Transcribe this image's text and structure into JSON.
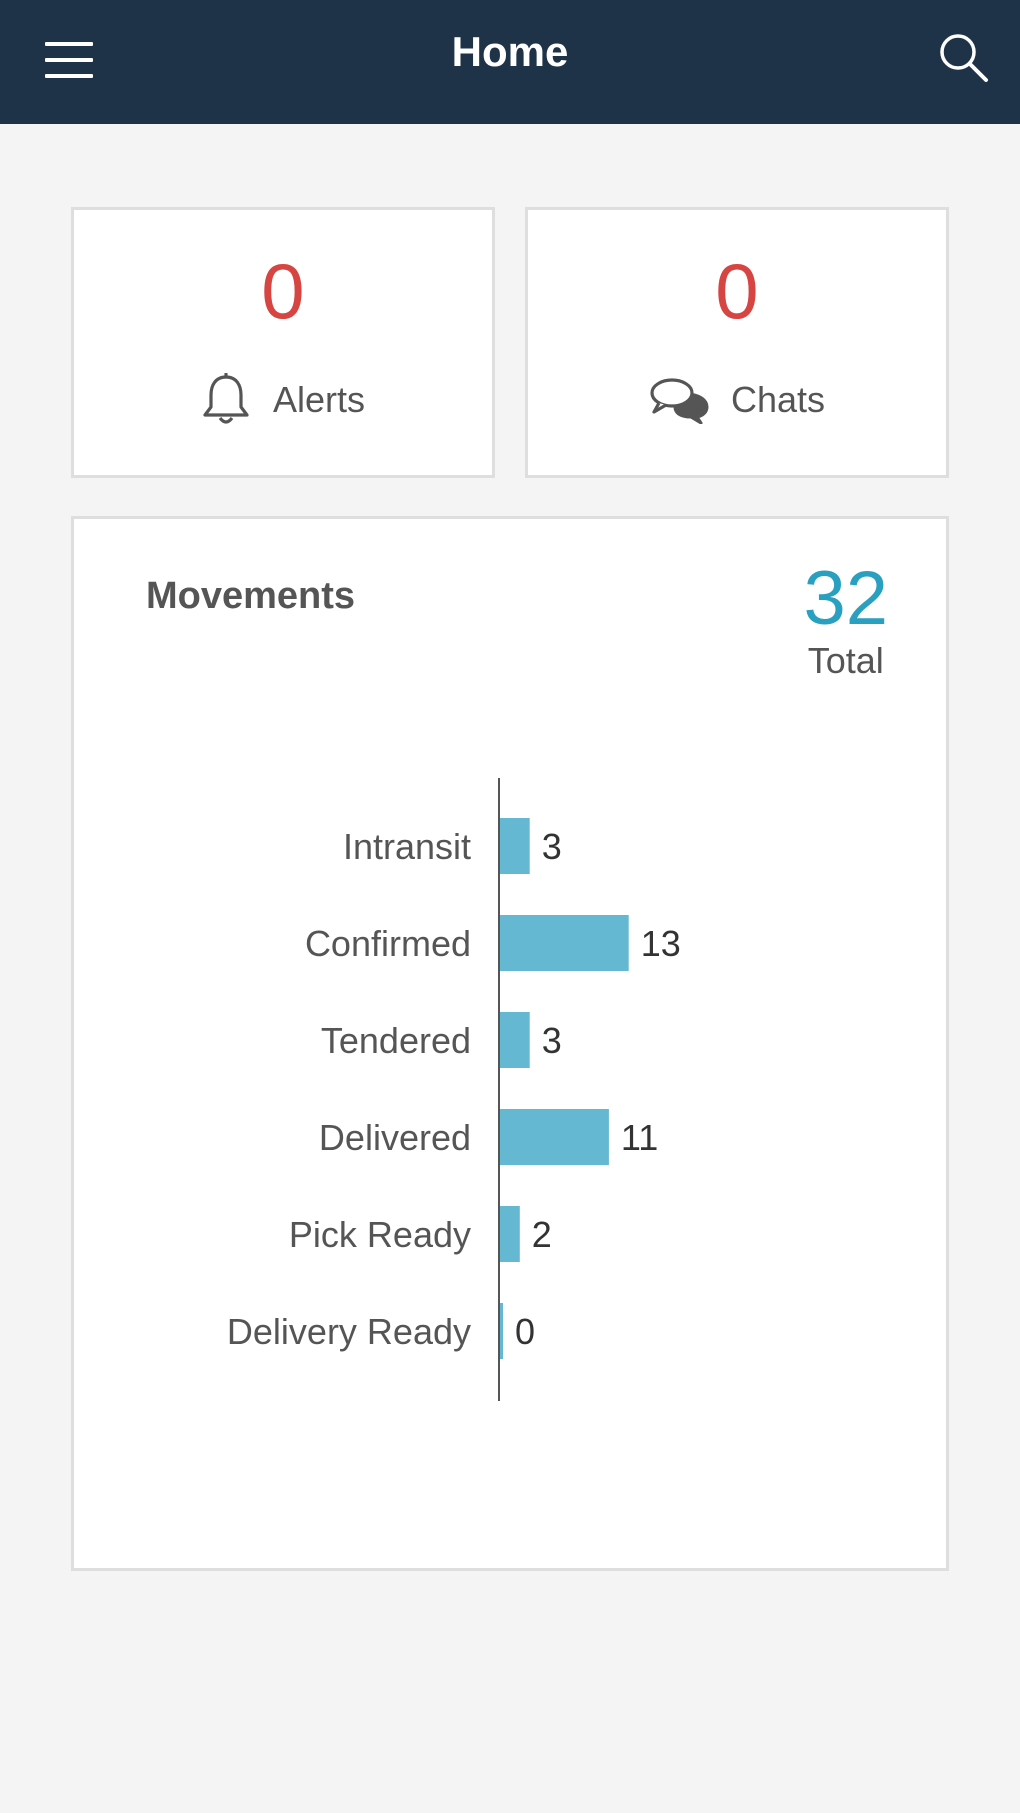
{
  "header": {
    "title": "Home",
    "background": "#1e3348"
  },
  "alerts": {
    "count": "0",
    "label": "Alerts",
    "icon": "bell-icon"
  },
  "chats": {
    "count": "0",
    "label": "Chats",
    "icon": "chat-bubbles-icon"
  },
  "movements": {
    "title": "Movements",
    "total_value": "32",
    "total_label": "Total"
  },
  "colors": {
    "count": "#d64541",
    "accent": "#2aa0c0",
    "bar": "#65b8d1",
    "text": "#555555"
  },
  "chart_data": {
    "type": "bar",
    "orientation": "horizontal",
    "categories": [
      "Intransit",
      "Confirmed",
      "Tendered",
      "Delivered",
      "Pick Ready",
      "Delivery Ready"
    ],
    "values": [
      3,
      13,
      3,
      11,
      2,
      0
    ],
    "data_labels": true,
    "grid": false
  }
}
